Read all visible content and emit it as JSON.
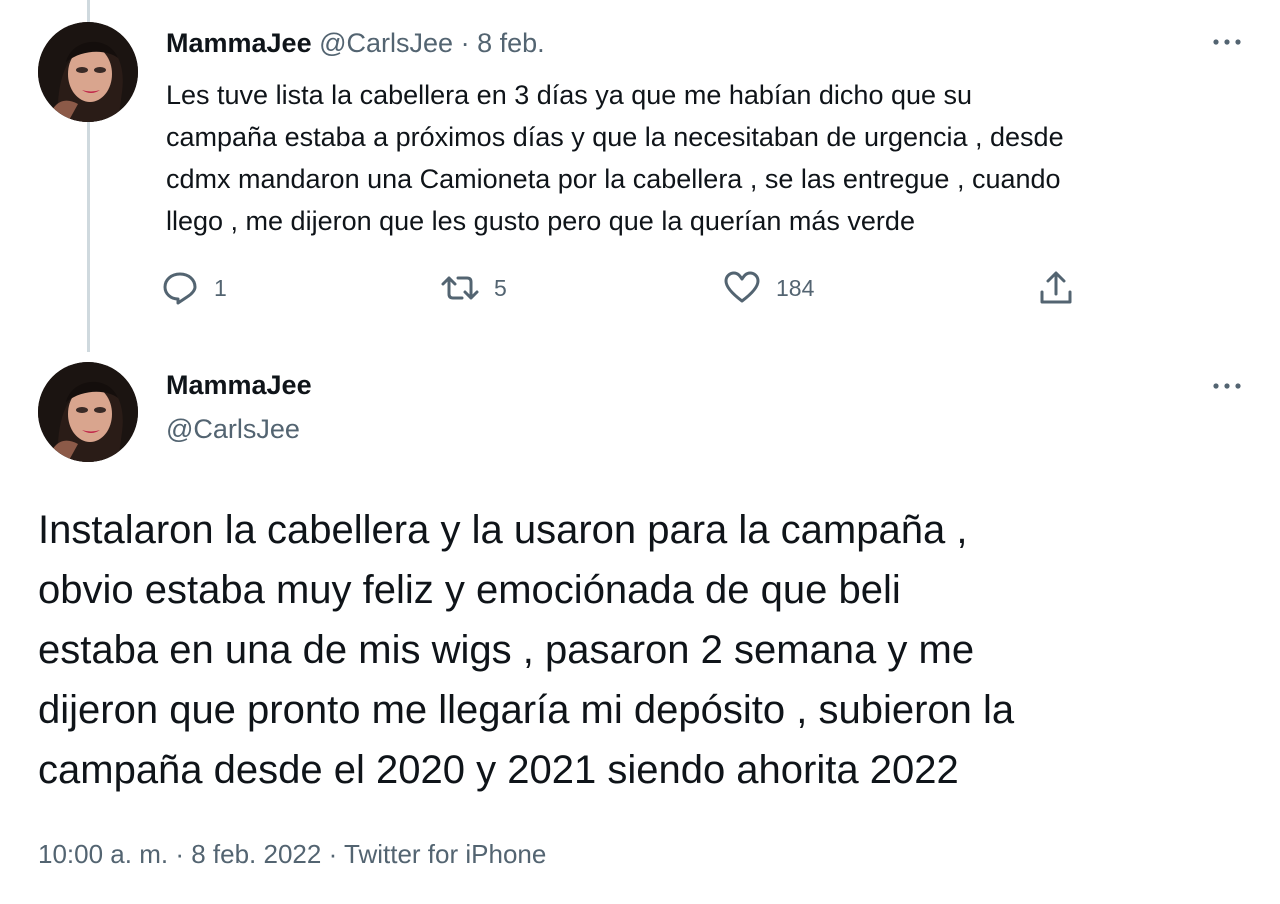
{
  "tweet1": {
    "display_name": "MammaJee",
    "handle": "@CarlsJee",
    "separator": "·",
    "date": "8 feb.",
    "more_icon": "more-icon",
    "lines": [
      "Les tuve lista la cabellera en 3 días ya que me habían dicho que su",
      "campaña estaba a próximos días y que la necesitaban de urgencia , desde",
      "cdmx mandaron una Camioneta por la cabellera , se las entregue , cuando",
      "llego , me dijeron que les gusto pero que la querían más verde"
    ],
    "actions": {
      "reply_count": "1",
      "retweet_count": "5",
      "like_count": "184"
    }
  },
  "tweet2": {
    "display_name": "MammaJee",
    "handle": "@CarlsJee",
    "lines": [
      "Instalaron la cabellera y la usaron para la campaña ,",
      "obvio estaba muy feliz y emociónada de que beli",
      "estaba en una de mis wigs , pasaron 2 semana y me",
      "dijeron que pronto me llegaría mi depósito , subieron la",
      "campaña desde el 2020 y 2021 siendo ahorita 2022"
    ],
    "time": "10:00 a. m.",
    "separator": "·",
    "date": "8 feb. 2022",
    "source": "Twitter for iPhone"
  },
  "colors": {
    "text": "#0f1419",
    "muted": "#536471",
    "thread_line": "#cfd9de"
  }
}
